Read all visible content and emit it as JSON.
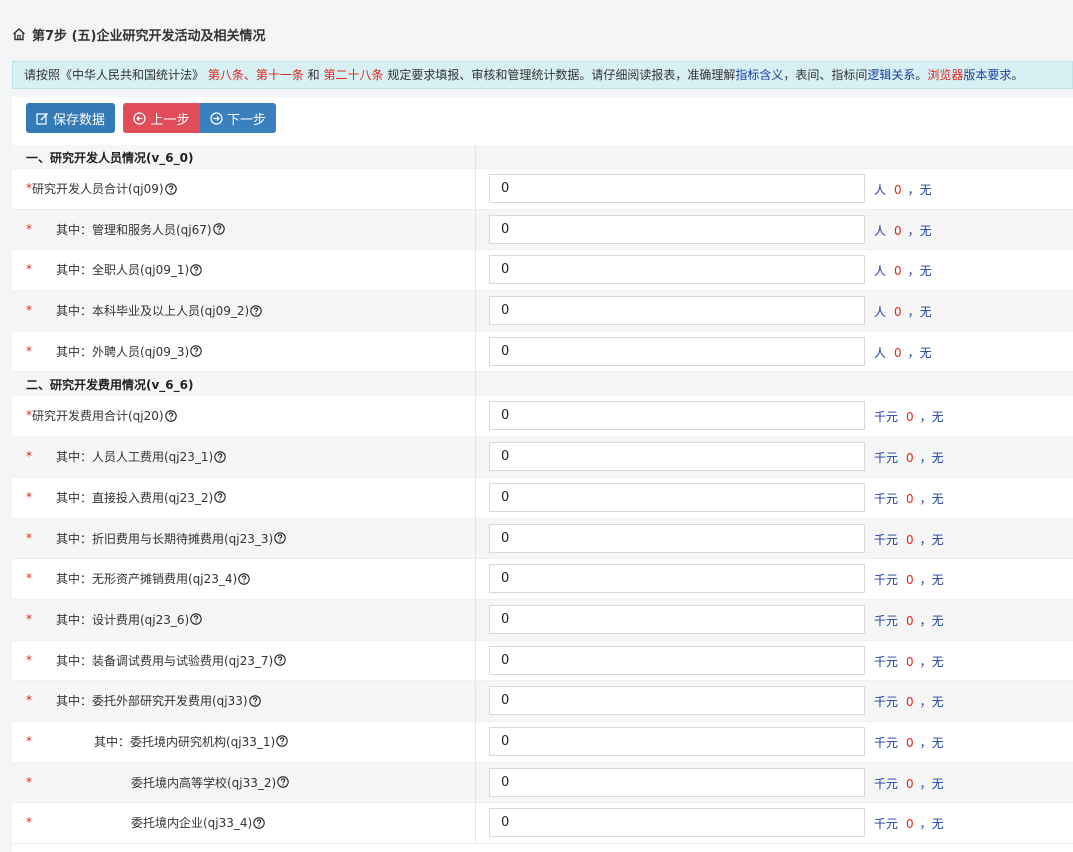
{
  "header": {
    "title": "第7步 (五)企业研究开发活动及相关情况"
  },
  "notice": {
    "p1": "请按照《中华人民共和国统计法》",
    "law1": "第八条、第十一条",
    "and": " 和 ",
    "law2": "第二十八条",
    "p2": " 规定要求填报、审核和管理统计数据。请仔细阅读报表，准确理解",
    "link1": "指标含义",
    "p3": "，表间、指标间",
    "link2": "逻辑关系",
    "p4": "。",
    "link3": "浏览器",
    "link4": "版本要求",
    "p5": "。"
  },
  "toolbar": {
    "save": "保存数据",
    "prev": "上一步",
    "next": "下一步"
  },
  "sections": [
    {
      "title": "一、研究开发人员情况(v_6_0)",
      "rows": [
        {
          "label": "研究开发人员合计(qj09)",
          "value": "0",
          "unit": "人",
          "count": "0",
          "note": "，无"
        },
        {
          "label": "其中：管理和服务人员(qj67)",
          "value": "0",
          "unit": "人",
          "count": "0",
          "note": "，无"
        },
        {
          "label": "其中：全职人员(qj09_1)",
          "value": "0",
          "unit": "人",
          "count": "0",
          "note": "，无"
        },
        {
          "label": "其中：本科毕业及以上人员(qj09_2)",
          "value": "0",
          "unit": "人",
          "count": "0",
          "note": "，无"
        },
        {
          "label": "其中：外聘人员(qj09_3)",
          "value": "0",
          "unit": "人",
          "count": "0",
          "note": "，无"
        }
      ]
    },
    {
      "title": "二、研究开发费用情况(v_6_6)",
      "rows": [
        {
          "label": "研究开发费用合计(qj20)",
          "value": "0",
          "unit": "千元",
          "count": "0",
          "note": "，无"
        },
        {
          "label": "其中：人员人工费用(qj23_1)",
          "value": "0",
          "unit": "千元",
          "count": "0",
          "note": "，无"
        },
        {
          "label": "其中：直接投入费用(qj23_2)",
          "value": "0",
          "unit": "千元",
          "count": "0",
          "note": "，无"
        },
        {
          "label": "其中：折旧费用与长期待摊费用(qj23_3)",
          "value": "0",
          "unit": "千元",
          "count": "0",
          "note": "，无"
        },
        {
          "label": "其中：无形资产摊销费用(qj23_4)",
          "value": "0",
          "unit": "千元",
          "count": "0",
          "note": "，无"
        },
        {
          "label": "其中：设计费用(qj23_6)",
          "value": "0",
          "unit": "千元",
          "count": "0",
          "note": "，无"
        },
        {
          "label": "其中：装备调试费用与试验费用(qj23_7)",
          "value": "0",
          "unit": "千元",
          "count": "0",
          "note": "，无"
        },
        {
          "label": "其中：委托外部研究开发费用(qj33)",
          "value": "0",
          "unit": "千元",
          "count": "0",
          "note": "，无"
        },
        {
          "label": "其中：委托境内研究机构(qj33_1)",
          "value": "0",
          "unit": "千元",
          "count": "0",
          "note": "，无"
        },
        {
          "label": "委托境内高等学校(qj33_2)",
          "value": "0",
          "unit": "千元",
          "count": "0",
          "note": "，无"
        },
        {
          "label": "委托境内企业(qj33_4)",
          "value": "0",
          "unit": "千元",
          "count": "0",
          "note": "，无"
        }
      ]
    }
  ]
}
